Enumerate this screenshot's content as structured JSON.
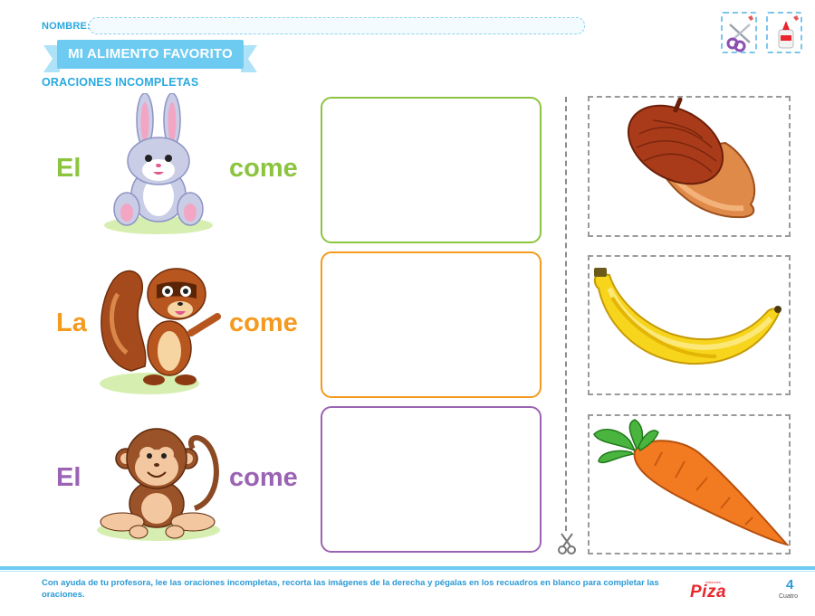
{
  "header": {
    "name_label": "NOMBRE:",
    "title": "MI ALIMENTO FAVORITO",
    "subtitle": "ORACIONES INCOMPLETAS"
  },
  "tools": [
    {
      "icon": "scissors-icon"
    },
    {
      "icon": "glue-icon"
    }
  ],
  "sentences": [
    {
      "article": "El",
      "animal": "rabbit",
      "verb": "come",
      "color": "#8cc43f"
    },
    {
      "article": "La",
      "animal": "squirrel",
      "verb": "come",
      "color": "#f39a1f"
    },
    {
      "article": "El",
      "animal": "monkey",
      "verb": "come",
      "color": "#9b63b3"
    }
  ],
  "food_cards": [
    {
      "food": "acorn"
    },
    {
      "food": "banana"
    },
    {
      "food": "carrot"
    }
  ],
  "footer": {
    "instructions": "Con ayuda de tu profesora, lee las oraciones incompletas, recorta las imágenes de la derecha y pégalas en los recuadros en blanco para completar las oraciones.",
    "brand": "Piza",
    "brand_small": "ediciones",
    "page_number": "4",
    "page_word": "Cuatro"
  }
}
